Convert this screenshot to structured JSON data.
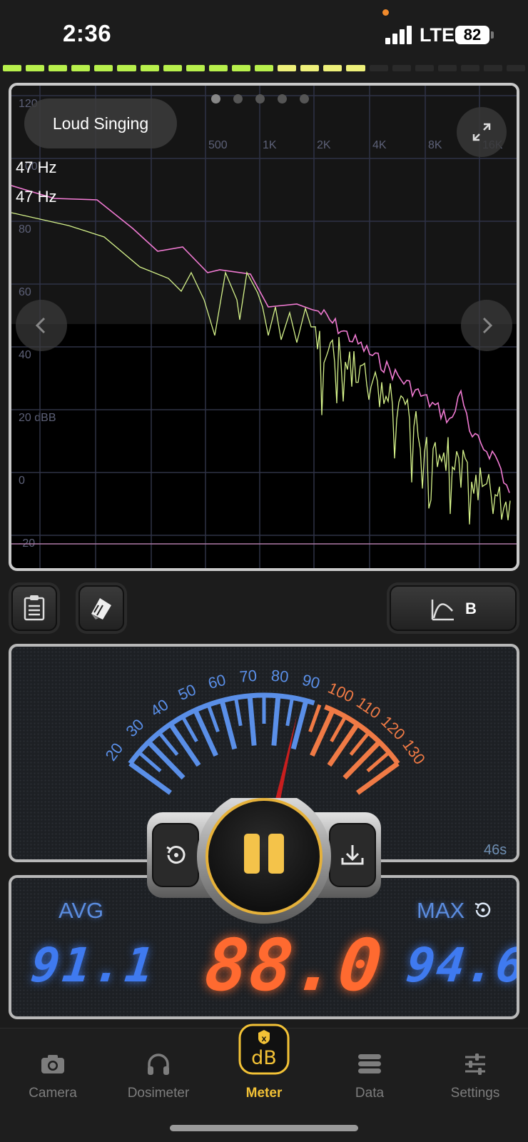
{
  "status_bar": {
    "time": "2:36",
    "network": "LTE",
    "battery": "82"
  },
  "level_meter": {
    "lit_green": 12,
    "lit_yellow": 4,
    "total": 23,
    "green_color": "#b8f04c",
    "yellow_color": "#eef07a"
  },
  "spectrum": {
    "preset_label": "Loud Singing",
    "page_count": 5,
    "active_page": 1,
    "peak_labels": [
      "47 Hz",
      "47 Hz"
    ],
    "y_ticks": [
      "120",
      "100",
      "80",
      "60",
      "40",
      "20 dBB",
      "0",
      "-20"
    ],
    "x_ticks": [
      "500",
      "1K",
      "2K",
      "4K",
      "8K",
      "16K"
    ],
    "series_colors": {
      "peak": "#f07ad2",
      "live": "#d5f28a"
    }
  },
  "toolbar": {
    "weighting_label": "B"
  },
  "meter": {
    "scale_low": [
      "20",
      "30",
      "40",
      "50",
      "60",
      "70",
      "80",
      "90"
    ],
    "scale_high": [
      "100",
      "110",
      "120",
      "130"
    ],
    "needle_value": 88.0,
    "elapsed": "46s",
    "colors": {
      "low": "#5a8fe8",
      "high": "#f07a45",
      "needle": "#c81e1e",
      "pause": "#f4c34a"
    }
  },
  "readouts": {
    "avg_label": "AVG",
    "max_label": "MAX",
    "avg_value": "91.1",
    "current_value": "88.0",
    "max_value": "94.6"
  },
  "tabs": [
    {
      "label": "Camera",
      "icon": "camera-icon"
    },
    {
      "label": "Dosimeter",
      "icon": "headphones-icon"
    },
    {
      "label": "Meter",
      "icon": "db-meter-icon"
    },
    {
      "label": "Data",
      "icon": "database-icon"
    },
    {
      "label": "Settings",
      "icon": "sliders-icon"
    }
  ],
  "active_tab": "Meter"
}
